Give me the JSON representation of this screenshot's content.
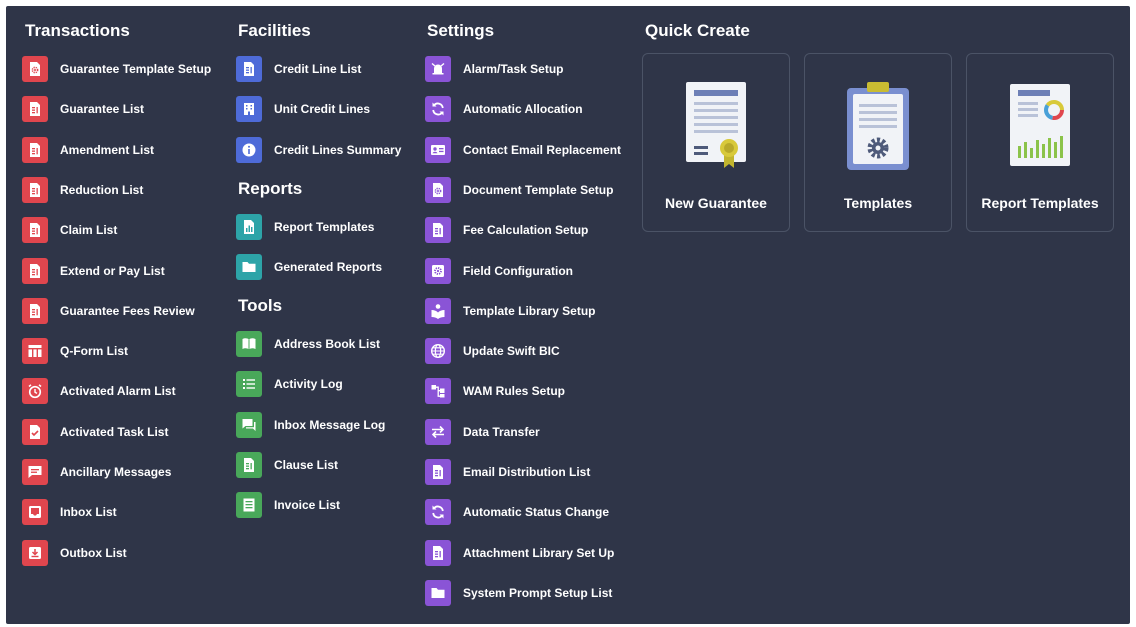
{
  "transactions": {
    "title": "Transactions",
    "items": [
      {
        "label": "Guarantee Template Setup",
        "icon": "doc-gear-icon"
      },
      {
        "label": "Guarantee List",
        "icon": "document-icon"
      },
      {
        "label": "Amendment List",
        "icon": "document-icon"
      },
      {
        "label": "Reduction List",
        "icon": "document-icon"
      },
      {
        "label": "Claim List",
        "icon": "document-icon"
      },
      {
        "label": "Extend or Pay List",
        "icon": "document-icon"
      },
      {
        "label": "Guarantee Fees Review",
        "icon": "document-icon"
      },
      {
        "label": "Q-Form List",
        "icon": "form-table-icon"
      },
      {
        "label": "Activated Alarm List",
        "icon": "alarm-clock-icon"
      },
      {
        "label": "Activated Task List",
        "icon": "doc-check-icon"
      },
      {
        "label": "Ancillary Messages",
        "icon": "message-icon"
      },
      {
        "label": "Inbox List",
        "icon": "inbox-icon"
      },
      {
        "label": "Outbox List",
        "icon": "outbox-icon"
      }
    ]
  },
  "facilities": {
    "title": "Facilities",
    "items": [
      {
        "label": "Credit Line List",
        "icon": "document-icon"
      },
      {
        "label": "Unit Credit Lines",
        "icon": "building-icon"
      },
      {
        "label": "Credit Lines Summary",
        "icon": "info-icon"
      }
    ]
  },
  "reports": {
    "title": "Reports",
    "items": [
      {
        "label": "Report Templates",
        "icon": "doc-chart-icon"
      },
      {
        "label": "Generated Reports",
        "icon": "folder-icon"
      }
    ]
  },
  "tools": {
    "title": "Tools",
    "items": [
      {
        "label": "Address Book List",
        "icon": "book-icon"
      },
      {
        "label": "Activity Log",
        "icon": "list-icon"
      },
      {
        "label": "Inbox Message Log",
        "icon": "chat-icon"
      },
      {
        "label": "Clause List",
        "icon": "document-icon"
      },
      {
        "label": "Invoice List",
        "icon": "invoice-icon"
      }
    ]
  },
  "settings": {
    "title": "Settings",
    "items": [
      {
        "label": "Alarm/Task Setup",
        "icon": "alarm-bell-icon"
      },
      {
        "label": "Automatic Allocation",
        "icon": "refresh-icon"
      },
      {
        "label": "Contact Email Replacement",
        "icon": "contact-card-icon"
      },
      {
        "label": "Document Template Setup",
        "icon": "doc-gear-icon"
      },
      {
        "label": "Fee Calculation Setup",
        "icon": "document-icon"
      },
      {
        "label": "Field Configuration",
        "icon": "gear-square-icon"
      },
      {
        "label": "Template Library Setup",
        "icon": "reader-icon"
      },
      {
        "label": "Update Swift BIC",
        "icon": "globe-icon"
      },
      {
        "label": "WAM Rules Setup",
        "icon": "flow-icon"
      },
      {
        "label": "Data Transfer",
        "icon": "transfer-icon"
      },
      {
        "label": "Email Distribution List",
        "icon": "document-icon"
      },
      {
        "label": "Automatic Status Change",
        "icon": "refresh-icon"
      },
      {
        "label": "Attachment Library Set Up",
        "icon": "document-icon"
      },
      {
        "label": "System Prompt Setup List",
        "icon": "folder-icon"
      }
    ]
  },
  "quick_create": {
    "title": "Quick Create",
    "cards": [
      {
        "label": "New Guarantee",
        "icon": "certificate-icon"
      },
      {
        "label": "Templates",
        "icon": "clipboard-gear-icon"
      },
      {
        "label": "Report Templates",
        "icon": "report-chart-icon"
      }
    ]
  },
  "colors": {
    "panel_bg": "#2f3548",
    "transactions": "#e0464e",
    "facilities": "#4e6bd8",
    "reports": "#2da4a8",
    "tools": "#49a85a",
    "settings": "#8a54d6"
  }
}
